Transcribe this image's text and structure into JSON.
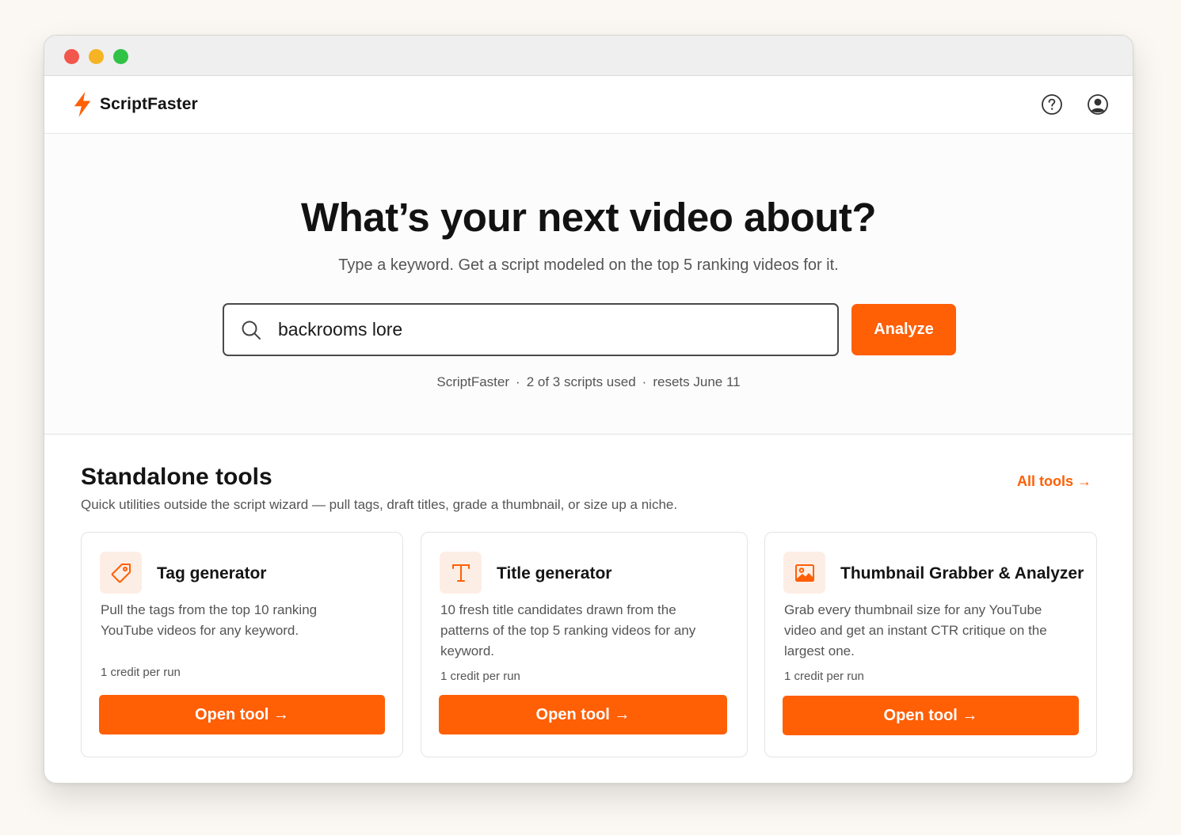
{
  "app": {
    "brand": "ScriptFaster",
    "help_icon": "help-circle-icon",
    "account_icon": "user-circle-icon",
    "accent_color": "#ff5f05"
  },
  "hero": {
    "title": "What’s your next video about?",
    "subtitle": "Type a keyword. Get a script modeled on the top 5 ranking videos for it.",
    "search_value": "backrooms lore",
    "analyze_label": "Analyze",
    "usage": {
      "brand": "ScriptFaster",
      "separator": "·",
      "scripts": "2 of 3 scripts used",
      "reset": "resets June 11"
    }
  },
  "tools": {
    "heading": "Standalone tools",
    "description": "Quick utilities outside the script wizard — pull tags, draft titles, grade a thumbnail, or size up a niche.",
    "all_tools_label": "All tools →",
    "cards": [
      {
        "icon": "tag-icon",
        "title": "Tag generator",
        "body": "Pull the tags from the top 10 ranking YouTube videos for any keyword.",
        "credit": "1 credit per run",
        "button": "Open tool →"
      },
      {
        "icon": "text-title-icon",
        "title": "Title generator",
        "body": "10 fresh title candidates drawn from the patterns of the top 5 ranking videos for any keyword.",
        "credit": "1 credit per run",
        "button": "Open tool →"
      },
      {
        "icon": "image-icon",
        "title": "Thumbnail Grabber & Analyzer",
        "body": "Grab every thumbnail size for any YouTube video and get an instant CTR critique on the largest one.",
        "credit": "1 credit per run",
        "button": "Open tool →"
      }
    ]
  }
}
